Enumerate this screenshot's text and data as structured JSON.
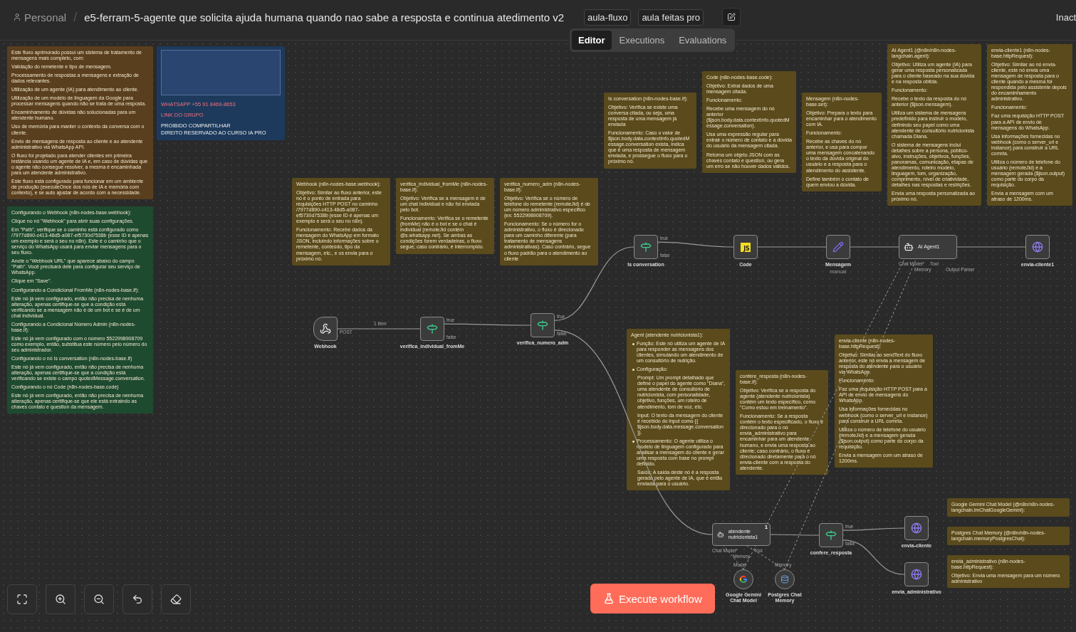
{
  "header": {
    "breadcrumb": "Personal",
    "separator": "/",
    "title": "e5-ferram-5-agente que solicita ajuda humana quando nao sabe a resposta e continua atedimento v2",
    "tags": [
      "aula-fluxo",
      "aula feitas pro"
    ],
    "status": "Inact"
  },
  "view_tabs": [
    {
      "label": "Editor",
      "selected": true
    },
    {
      "label": "Executions",
      "selected": false
    },
    {
      "label": "Evaluations",
      "selected": false
    }
  ],
  "sticky_notes": [
    {
      "kind": "banner",
      "color": "#1d3a5c",
      "lines": [
        {
          "text": "WHATSAPP +55 91 8469-8653",
          "accent": true
        },
        {
          "text": "LINK DO GRUPO",
          "accent": true
        },
        {
          "text": "PROIBIDO COMPARTILHAR",
          "accent": false
        },
        {
          "text": "DIREITO RESERVADO AO CURSO IA PRO",
          "accent": false
        }
      ]
    },
    {
      "kind": "text",
      "color": "#5a3f1e",
      "paragraphs": [
        "Este fluxo aprimorado possui um sistema de tratamento de mensagens mais completo, com:",
        "Validação do remetente e tipo de mensagem.",
        "Processamento de respostas a mensagens e extração de dados relevantes.",
        "Utilização de um agente (IA) para atendimento ao cliente.",
        "Utilização de um modelo de linguagem da Google para processar mensagens quando não se trata de uma resposta.",
        "Encaminhamento de dúvidas não solucionadas para um atendente humano.",
        "Uso de memória para manter o contexto da conversa com o cliente.",
        "Envio de mensagens de resposta ao cliente e ao atendente administrativo via WhatsApp API.",
        "O fluxo foi projetado para atender clientes em primeira instância usando um agente de IA e, em caso de dúvidas que o agente não consegue resolver, a mesma é encaminhada para um atendente administrativo.",
        "Este fluxo está configurado para funcionar em um ambiente de produção (executeOnce dos nós de IA e memória com contexto), e se auto ajustar de acordo com a necessidade."
      ]
    },
    {
      "kind": "text",
      "color": "#1e4a30",
      "paragraphs": [
        "Configurando o Webhook (n8n-nodes-base.webhook):",
        "Clique no nó \"Webhook\" para abrir suas configurações.",
        "Em \"Path\", verifique se o caminho está configurado como /7977d890-c413-48d5-a087-ef5730d7538b (esse ID é apenas um exemplo e será o seu no n8n). Este é o caminho que o serviço do WhatsApp usará para enviar mensagens para o seu fluxo.",
        "Anote o \"Webhook URL\" que aparece abaixo do campo \"Path\". Você precisará dele para configurar seu serviço de WhatsApp.",
        "Clique em \"Save\".",
        "Configurando a Condicional FromMe (n8n-nodes-base.if):",
        "Este nó já vem configurado, então não precisa de nenhuma alteração, apenas certifique-se que a condição está verificando se a mensagem não é de um bot e se é de um chat individual.",
        "Configurando a Condicional Número Admin (n8n-nodes-base.if):",
        "Este nó já vem configurado com o número 5522998908709 como exemplo, então, substitua este número pelo número do seu administrador.",
        "Configurando o nó Is conversation (n8n-nodes-base.if)",
        "Este nó já vem configurado, então não precisa de nenhuma alteração, apenas certifique-se que a condição está verificando se existe o campo quotedMessage.conversation.",
        "Configurando o nó Code (n8n-nodes-base.code)",
        "Este nó já vem configurado, então não precisa de nenhuma alteração, apenas certifique-se que ele está extraindo as chaves contato e question da mensagem."
      ]
    },
    {
      "kind": "text",
      "color": "#5a4a1c",
      "paragraphs": [
        "Webhook (n8n-nodes-base.webhook):",
        "Objetivo: Similar ao fluxo anterior, este nó é o ponto de entrada para requisições HTTP POST no caminho /7977d890-c413-48d5-a087-ef5730d7538b (esse ID é apenas um exemplo e será o seu no n8n).",
        "Funcionamento: Recebe dados da mensagem do WhatsApp em formato JSON, incluindo informações sobre o remetente, conteúdo, tipo da mensagem, etc., e os envia para o próximo nó."
      ]
    },
    {
      "kind": "text",
      "color": "#5a4a1c",
      "paragraphs": [
        "verifica_individual_fromMe (n8n-nodes-base.if):",
        "Objetivo: Verifica se a mensagem é de um chat individual e não foi enviada pelo bot.",
        "Funcionamento: Verifica se o remetente (fromMe) não é o bot e se o chat é individual (remoteJid contém @s.whatsapp.net). Se ambas as condições forem verdadeiras, o fluxo segue; caso contrário, é interrompido."
      ]
    },
    {
      "kind": "text",
      "color": "#5a4a1c",
      "paragraphs": [
        "verifica_numero_adm (n8n-nodes-base.if):",
        "Objetivo: Verifica se o número de telefone do remetente (remoteJid) é de um número administrativo específico (ex: 5522998908709).",
        "Funcionamento: Se o número for o administrativo, o fluxo é direcionado para um caminho diferente (para tratamento de mensagens administrativas). Caso contrário, segue o fluxo padrão para o atendimento ao cliente"
      ]
    },
    {
      "kind": "text",
      "color": "#5a4a1c",
      "paragraphs": [
        "Is conversation (n8n-nodes-base.if):",
        "Objetivo: Verifica se existe uma conversa citada, ou seja, uma resposta de uma mensagem já enviada",
        "Funcionamento: Caso o valor de $json.body.data.contextInfo.quotedMessage.conversation exista, indica que é uma resposta de mensagem enviada, e prossegue o fluxo para o próximo nó."
      ]
    },
    {
      "kind": "text",
      "color": "#5a4a1c",
      "paragraphs": [
        "Code (n8n-nodes-base.code):",
        "Objetivo: Extrai dados de uma mensagem citada.",
        "Funcionamento:",
        "Recebe uma mensagem do nó anterior ($json.body.data.contextInfo.quotedMessage.conversation).",
        "Usa uma expressão regular para extrair o número de contato e a dúvida do usuário da mensagem citada.",
        "Retorna um objeto JSON com as chaves contato e question, ou gera um erro se não houver dados válidos."
      ]
    },
    {
      "kind": "text",
      "color": "#5a4a1c",
      "paragraphs": [
        "Mensagem (n8n-nodes-base.set):",
        "Objetivo: Prepara o texto para encaminhar para o atendimento com IA.",
        "Funcionamento:",
        "Recebe as chaves do nó anterior, e usa para compor uma mensagem concatenando o texto da dúvida original do usuário e a resposta para o atendimento do assistente.",
        "Define também o contato de quem enviou a dúvida."
      ]
    },
    {
      "kind": "text",
      "color": "#5a4a1c",
      "paragraphs": [
        "AI Agent1 (@n8n/n8n-nodes-langchain.agent):",
        "Objetivo: Utiliza um agente (IA) para gerar uma resposta personalizada para o cliente baseado na sua dúvida e na resposta obtida.",
        "Funcionamento:",
        "Recebe o texto da resposta do nó anterior ($json.mensagem).",
        "Utiliza um sistema de mensagens predefinido para instruir o modelo, definindo seu papel como uma atendente de consultório nutricionista chamada Diana.",
        "O sistema de mensagens inclui detalhes sobre a persona, público-alvo, instruções, objetivos, funções, panoramas, comunicação, etapas de atendimento, roteiro modelo, linguagem, tom, organização, comprimento, nível de criatividade, detalhes nas respostas e restrições.",
        "Envia uma resposta personalizada ao próximo nó."
      ]
    },
    {
      "kind": "text",
      "color": "#5a4a1c",
      "paragraphs": [
        "envia-cliente1 (n8n-nodes-base.httpRequest):",
        "Objetivo: Similar ao nó envia-cliente, este nó envia uma mensagem de resposta para o cliente quando a mesma foi respondida pelo assistente depois do encaminhamento administrativo.",
        "Funcionamento:",
        "Faz uma requisição HTTP POST para a API de envio de mensagens do WhatsApp.",
        "Usa informações fornecidas no webhook (como o server_url e instance) para construir a URL correta.",
        "Utiliza o número de telefone do usuário (remoteJid) e a mensagem gerada ($json.output) como parte do corpo da requisição.",
        "Envia a mensagem com um atraso de 1200ms."
      ]
    },
    {
      "kind": "text",
      "color": "#5a4a1c",
      "paragraphs": [
        "Agent (atendente nutricionista1):",
        {
          "kind": "bullet",
          "text": "Função: Este nó utiliza um agente de IA para responder as mensagens dos clientes, simulando um atendimento de um consultório de nutrição."
        },
        {
          "kind": "bullet",
          "text": "Configuração:"
        },
        {
          "kind": "sub",
          "text": "Prompt: Um prompt detalhado que define o papel do agente como \"Diana\", uma atendente de consultório de nutricionista, com personalidade, objetivo, funções, um roteiro de atendimento, tom de voz, etc."
        },
        {
          "kind": "sub",
          "text": "Input: O texto da mensagem do cliente é recebido do input como {{ $json.body.data.message.conversation }}."
        },
        {
          "kind": "bullet",
          "text": "Processamento: O agente utiliza o modelo de linguagem configurado para analisar a mensagem do cliente e gerar uma resposta com base no prompt definido."
        },
        {
          "kind": "sub",
          "text": "Saída: A saída deste nó é a resposta gerada pelo agente de IA, que é então enviada para o usuário."
        }
      ]
    },
    {
      "kind": "text",
      "color": "#5a4a1c",
      "paragraphs": [
        "confere_resposta (n8n-nodes-base.if):",
        "Objetivo: Verifica se a resposta do agente (atendente nutricionista) contém um texto específico, como \"Como estou em treinamento\".",
        "Funcionamento: Se a resposta contém o texto especificado, o fluxo é direcionado para o nó envia_administrativo para encaminhar para um atendente humano, e envia uma resposta ao cliente; caso contrário, o fluxo é direcionado diretamente para o nó envia-cliente com a resposta do atendente."
      ]
    },
    {
      "kind": "text",
      "color": "#5a4a1c",
      "paragraphs": [
        "envia-cliente (n8n-nodes-base.httpRequest):",
        "Objetivo: Similar ao sendText do fluxo anterior, este nó envia a mensagem de resposta do atendente para o usuário via WhatsApp.",
        "Funcionamento:",
        "Faz uma requisição HTTP POST para a API de envio de mensagens do WhatsApp.",
        "Usa informações fornecidas no webhook (como o server_url e instance) para construir a URL correta.",
        "Utiliza o número de telefone do usuário (remoteJid) e a mensagem gerada ($json.output) como parte do corpo da requisição.",
        "Envia a mensagem com um atraso de 1200ms."
      ]
    },
    {
      "kind": "text",
      "color": "#5a4a1c",
      "paragraphs": [
        "Google Gemini Chat Model (@n8n/n8n-nodes-langchain.lmChatGoogleGemini):"
      ]
    },
    {
      "kind": "text",
      "color": "#5a4a1c",
      "paragraphs": [
        "Postgres Chat Memory (@n8n/n8n-nodes-langchain.memoryPostgresChat):"
      ]
    },
    {
      "kind": "text",
      "color": "#5a4a1c",
      "paragraphs": [
        "envia_administrativo (n8n-nodes-base.httpRequest):",
        "Objetivo: Envia uma mensagem para um número administrativo"
      ]
    }
  ],
  "nodes": [
    {
      "label": "Webhook",
      "kind": "webhook",
      "outputs": [
        "POST"
      ]
    },
    {
      "label": "verifica_individual_fromMe",
      "kind": "if",
      "outputs": [
        "true",
        "false"
      ]
    },
    {
      "label": "verifica_numero_adm",
      "kind": "if",
      "outputs": [
        "true",
        "false"
      ]
    },
    {
      "label": "Is conversation",
      "kind": "if",
      "outputs": [
        "true",
        "false"
      ]
    },
    {
      "label": "Code",
      "kind": "code",
      "icon_text": "JS"
    },
    {
      "label": "Mensagem",
      "subtitle": "manual",
      "kind": "set"
    },
    {
      "label": "AI Agent1",
      "kind": "agent",
      "inputs": [
        "Chat Model*",
        "Memory",
        "Tool",
        "Output Parser"
      ]
    },
    {
      "label": "envia-cliente1",
      "kind": "http"
    },
    {
      "label": "atendente nutricionista1",
      "kind": "agent",
      "badge": "1",
      "inputs": [
        "Chat Model*",
        "Memory",
        "Tool"
      ]
    },
    {
      "label": "confere_resposta",
      "kind": "if",
      "outputs": [
        "true",
        "false"
      ]
    },
    {
      "label": "envia-cliente",
      "kind": "http"
    },
    {
      "label": "Google Gemini Chat Model",
      "kind": "gemini",
      "port": "Model"
    },
    {
      "label": "Postgres Chat Memory",
      "kind": "memory",
      "port": "Memory"
    },
    {
      "label": "envia_administrativo",
      "kind": "http"
    }
  ],
  "edge_labels": [
    "1 item"
  ],
  "execute_button": "Execute workflow"
}
